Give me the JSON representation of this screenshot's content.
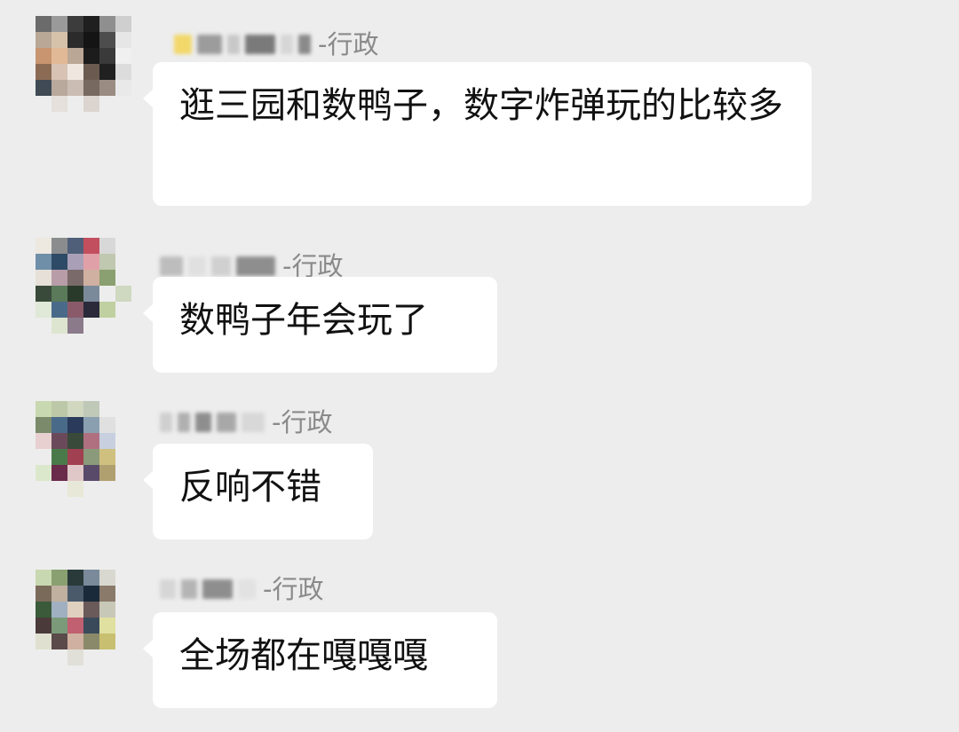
{
  "messages": [
    {
      "sender_suffix": "-行政",
      "text": "逛三园和数鸭子，数字炸弹玩的比较多",
      "avatar_colors": [
        "#6b6b6b",
        "#9a9a9a",
        "#3c3c3c",
        "#1f1f1f",
        "#8f8f8f",
        "#cfcfcf",
        "#b8a895",
        "#d6c1ab",
        "#2b2b2b",
        "#141414",
        "#4d4d4d",
        "#e6e6e6",
        "#c89570",
        "#e2b996",
        "#bba796",
        "#1c1c1c",
        "#3a3a3a",
        "#f0f0f0",
        "#8c6b55",
        "#d7c2b4",
        "#efe6e0",
        "#6a5a50",
        "#202020",
        "#dcdcdc",
        "#3f4a55",
        "#b9a89c",
        "#cbbcb4",
        "#77695f",
        "#9a8c82",
        "#e9e9e9",
        "#ededed",
        "#e5e0dc",
        "#ededed",
        "#dcd5cf",
        "#ededed",
        "#ededed"
      ]
    },
    {
      "sender_suffix": "-行政",
      "text": "数鸭子年会玩了",
      "avatar_colors": [
        "#ede8e0",
        "#8a8c8e",
        "#4f5f7a",
        "#c24f5e",
        "#d8d8d8",
        "#ededed",
        "#6f8fa8",
        "#2d4a66",
        "#a9a0b8",
        "#e0a0a8",
        "#c0c8b0",
        "#ededed",
        "#e6e0d8",
        "#b89ca8",
        "#7a6a6a",
        "#d0b0a0",
        "#8aa070",
        "#ededed",
        "#3a4a3a",
        "#5a7a5a",
        "#2a3a2a",
        "#7a8a9a",
        "#ededed",
        "#cfd8c0",
        "#e0e8d8",
        "#4a6a8a",
        "#8a5a6a",
        "#2a2a3a",
        "#c0d0a0",
        "#ededed",
        "#ededed",
        "#dde5d0",
        "#8a7a8a",
        "#ededed",
        "#ededed",
        "#ededed"
      ]
    },
    {
      "sender_suffix": "-行政",
      "text": "反响不错",
      "avatar_colors": [
        "#c8d8b0",
        "#bcc8a8",
        "#d0d8c0",
        "#c0c8b8",
        "#ededed",
        "#ededed",
        "#7a8a6a",
        "#4a6a8a",
        "#2a3a5a",
        "#8aa0b0",
        "#e0e0e0",
        "#ededed",
        "#e8d0d0",
        "#6a4a5a",
        "#3a4a3a",
        "#b07080",
        "#c8d0e0",
        "#ededed",
        "#ededed",
        "#4a7a4a",
        "#a04050",
        "#8a9a7a",
        "#d0c080",
        "#ededed",
        "#dce8cc",
        "#6a2a4a",
        "#e0c8c8",
        "#5a4a6a",
        "#b0a070",
        "#ededed",
        "#ededed",
        "#ededed",
        "#e8e8d8",
        "#ededed",
        "#ededed",
        "#ededed"
      ]
    },
    {
      "sender_suffix": "-行政",
      "text": "全场都在嘎嘎嘎",
      "avatar_colors": [
        "#c8d8b0",
        "#8aa070",
        "#2a3a3a",
        "#7a8a9a",
        "#d8d8d0",
        "#ededed",
        "#7a6a5a",
        "#c0b0a0",
        "#4a5a6a",
        "#1a2a3a",
        "#8a7a6a",
        "#ededed",
        "#3a5a3a",
        "#a0b0c0",
        "#e0d0c0",
        "#6a5a5a",
        "#c8c8b8",
        "#ededed",
        "#4a3a3a",
        "#7a9a7a",
        "#c06070",
        "#3a4a5a",
        "#e0e0a0",
        "#ededed",
        "#e0e0d0",
        "#5a4a4a",
        "#d0b0a0",
        "#8a8a6a",
        "#c8c070",
        "#ededed",
        "#ededed",
        "#ededed",
        "#e0e0d8",
        "#ededed",
        "#ededed",
        "#ededed"
      ]
    }
  ]
}
